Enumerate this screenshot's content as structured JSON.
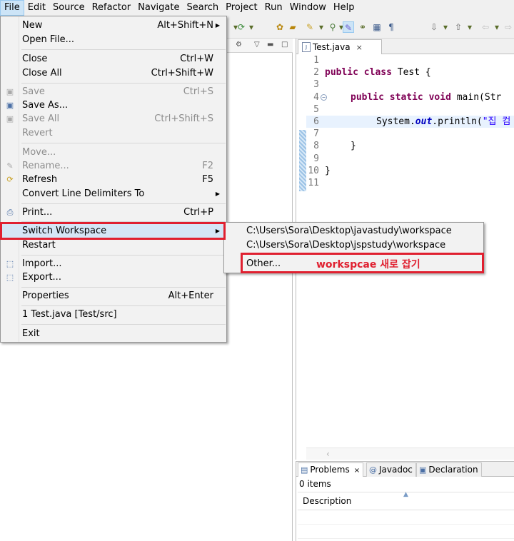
{
  "menubar": {
    "items": [
      "File",
      "Edit",
      "Source",
      "Refactor",
      "Navigate",
      "Search",
      "Project",
      "Run",
      "Window",
      "Help"
    ]
  },
  "file_menu": {
    "new_label": "New",
    "new_accel": "Alt+Shift+N",
    "open_file_label": "Open File...",
    "close_label": "Close",
    "close_accel": "Ctrl+W",
    "close_all_label": "Close All",
    "close_all_accel": "Ctrl+Shift+W",
    "save_label": "Save",
    "save_accel": "Ctrl+S",
    "save_as_label": "Save As...",
    "save_all_label": "Save All",
    "save_all_accel": "Ctrl+Shift+S",
    "revert_label": "Revert",
    "move_label": "Move...",
    "rename_label": "Rename...",
    "rename_accel": "F2",
    "refresh_label": "Refresh",
    "refresh_accel": "F5",
    "convert_label": "Convert Line Delimiters To",
    "print_label": "Print...",
    "print_accel": "Ctrl+P",
    "switch_workspace_label": "Switch Workspace",
    "restart_label": "Restart",
    "import_label": "Import...",
    "export_label": "Export...",
    "properties_label": "Properties",
    "properties_accel": "Alt+Enter",
    "recent_file_label": "1 Test.java  [Test/src]",
    "exit_label": "Exit"
  },
  "switch_submenu": {
    "workspace1": "C:\\Users\\Sora\\Desktop\\javastudy\\workspace",
    "workspace2": "C:\\Users\\Sora\\Desktop\\jspstudy\\workspace",
    "other_label": "Other..."
  },
  "annotation": {
    "text": "workspcae 새로 잡기",
    "color": "#e02030"
  },
  "editor": {
    "tab_label": "Test.java",
    "tab_close": "×",
    "line_numbers": [
      "1",
      "2",
      "3",
      "4",
      "5",
      "6",
      "7",
      "8",
      "9",
      "10",
      "11"
    ],
    "code": {
      "l2_kw1": "public",
      "l2_kw2": "class",
      "l2_name": "Test {",
      "l4_kw1": "public",
      "l4_kw2": "static",
      "l4_kw3": "void",
      "l4_rest": "main(Str",
      "l6_pre": "System.",
      "l6_field": "out",
      "l6_call": ".println(",
      "l6_str": "\"집 컴",
      "l8": "}",
      "l10": "}"
    }
  },
  "problems": {
    "tabs": [
      "Problems",
      "Javadoc",
      "Declaration"
    ],
    "item_count": "0 items",
    "column_description": "Description"
  },
  "colors": {
    "keyword": "#7f0055",
    "string": "#2a00ff",
    "field": "#0000c0",
    "highlight_line": "#e8f2fe",
    "menu_hover": "#d5e6f6"
  }
}
